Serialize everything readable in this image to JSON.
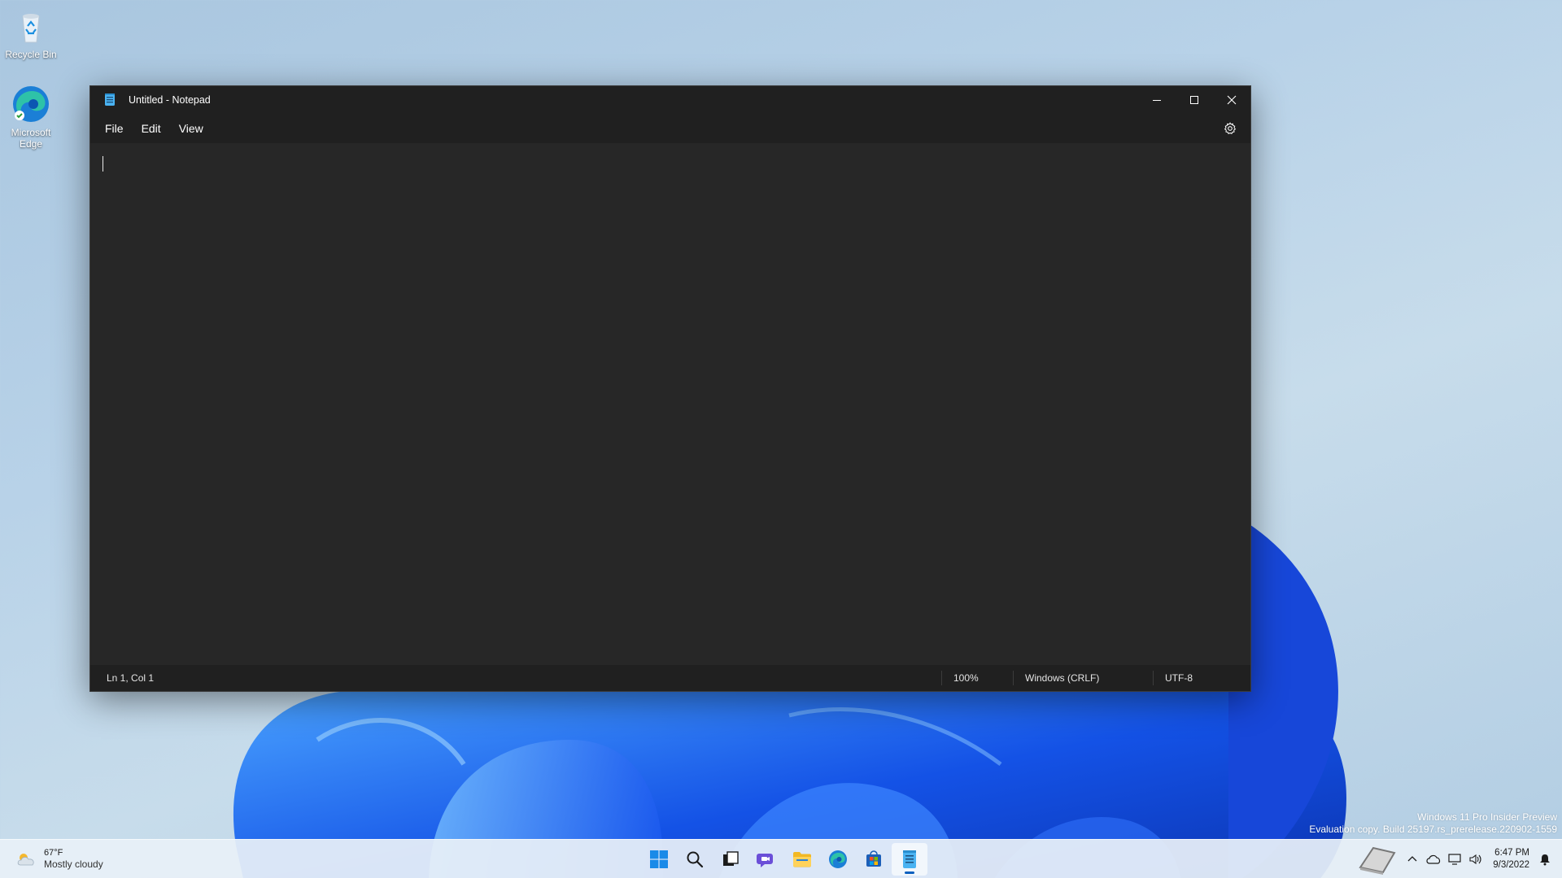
{
  "desktop": {
    "icons": [
      {
        "label": "Recycle Bin",
        "icon": "recycle-bin-icon"
      },
      {
        "label": "Microsoft Edge",
        "icon": "edge-icon"
      }
    ],
    "watermark": {
      "line1": "Windows 11 Pro Insider Preview",
      "line2": "Evaluation copy. Build 25197.rs_prerelease.220902-1559"
    }
  },
  "window": {
    "title": "Untitled - Notepad",
    "menu": {
      "file": "File",
      "edit": "Edit",
      "view": "View"
    },
    "editor_text": "",
    "status": {
      "position": "Ln 1, Col 1",
      "zoom": "100%",
      "line_ending": "Windows (CRLF)",
      "encoding": "UTF-8"
    },
    "colors": {
      "background": "#272727",
      "chrome": "#202020",
      "text": "#ffffff"
    }
  },
  "taskbar": {
    "weather": {
      "temp": "67°F",
      "condition": "Mostly cloudy"
    },
    "apps": [
      {
        "name": "Start",
        "icon": "windows-start-icon"
      },
      {
        "name": "Search",
        "icon": "search-icon"
      },
      {
        "name": "Task View",
        "icon": "task-view-icon"
      },
      {
        "name": "Chat",
        "icon": "chat-icon"
      },
      {
        "name": "File Explorer",
        "icon": "folder-icon"
      },
      {
        "name": "Microsoft Edge",
        "icon": "edge-icon"
      },
      {
        "name": "Microsoft Store",
        "icon": "store-icon"
      },
      {
        "name": "Notepad",
        "icon": "notepad-icon"
      }
    ],
    "clock": {
      "time": "6:47 PM",
      "date": "9/3/2022"
    },
    "accent": "#0a5fbf"
  }
}
